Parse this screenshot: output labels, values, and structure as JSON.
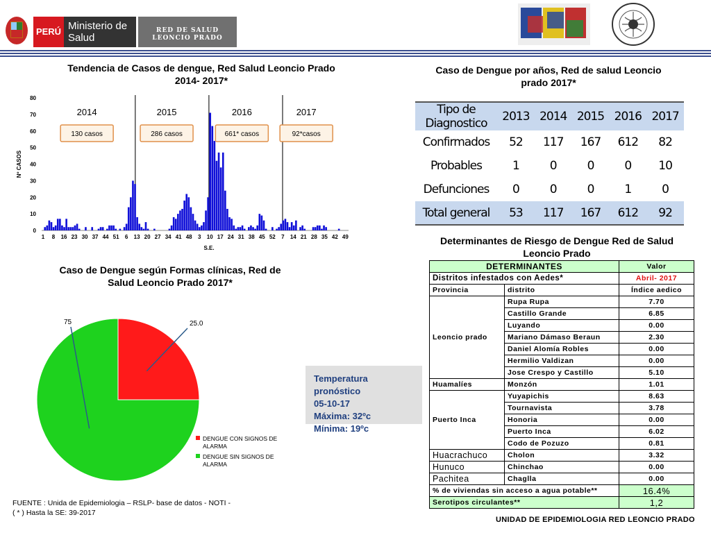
{
  "header": {
    "peru_label": "PERÚ",
    "ministerio_label": "Ministerio de Salud",
    "red_label_1": "RED DE SALUD",
    "red_label_2": "LEONCIO PRADO"
  },
  "chart_data": [
    {
      "type": "bar",
      "title": "Tendencia de Casos de dengue, Red Salud Leoncio Prado 2014- 2017*",
      "xlabel": "S.E.",
      "ylabel": "Nº CASOS",
      "ylim": [
        0,
        80
      ],
      "yticks": [
        "0",
        "10",
        "20",
        "30",
        "40",
        "50",
        "60",
        "70",
        "80"
      ],
      "xticks": [
        "1",
        "8",
        "16",
        "23",
        "30",
        "37",
        "44",
        "51",
        "6",
        "13",
        "20",
        "27",
        "34",
        "41",
        "48",
        "3",
        "10",
        "17",
        "24",
        "31",
        "38",
        "45",
        "52",
        "7",
        "14",
        "21",
        "28",
        "35",
        "42",
        "49"
      ],
      "values": [
        0,
        2,
        3,
        6,
        5,
        2,
        3,
        7,
        7,
        3,
        2,
        7,
        2,
        2,
        2,
        3,
        4,
        1,
        0,
        0,
        2,
        0,
        0,
        2,
        0,
        0,
        1,
        2,
        2,
        0,
        1,
        3,
        3,
        3,
        1,
        0,
        1,
        0,
        2,
        4,
        14,
        20,
        30,
        28,
        8,
        4,
        2,
        1,
        5,
        1,
        0,
        0,
        1,
        0,
        0,
        0,
        0,
        0,
        0,
        1,
        3,
        8,
        7,
        10,
        12,
        13,
        18,
        22,
        20,
        14,
        10,
        6,
        4,
        2,
        3,
        5,
        12,
        20,
        71,
        63,
        54,
        42,
        47,
        38,
        47,
        24,
        13,
        8,
        7,
        3,
        1,
        2,
        2,
        3,
        1,
        0,
        2,
        3,
        2,
        1,
        3,
        10,
        9,
        6,
        1,
        0,
        0,
        2,
        0,
        1,
        2,
        4,
        6,
        7,
        5,
        2,
        5,
        3,
        6,
        0,
        2,
        3,
        1,
        0,
        0,
        0,
        2,
        2,
        3,
        3,
        1,
        3,
        2,
        0,
        0,
        0,
        0,
        0,
        1,
        0,
        0,
        0,
        0
      ],
      "periods": [
        {
          "year": "2014",
          "cases": "130 casos"
        },
        {
          "year": "2015",
          "cases": "286 casos"
        },
        {
          "year": "2016",
          "cases": "661* casos"
        },
        {
          "year": "2017",
          "cases": "92*casos"
        }
      ]
    },
    {
      "type": "table",
      "title": "Caso de Dengue por años, Red de salud Leoncio prado 2017*",
      "columns": [
        "Tipo de Diagnostico",
        "2013",
        "2014",
        "2015",
        "2016",
        "2017"
      ],
      "rows": [
        [
          "Confirmados",
          "52",
          "117",
          "167",
          "612",
          "82"
        ],
        [
          "Probables",
          "1",
          "0",
          "0",
          "0",
          "10"
        ],
        [
          "Defunciones",
          "0",
          "0",
          "0",
          "1",
          "0"
        ],
        [
          "Total general",
          "53",
          "117",
          "167",
          "612",
          "92"
        ]
      ]
    },
    {
      "type": "pie",
      "title": "Caso de Dengue según Formas clínicas, Red de Salud Leoncio Prado 2017*",
      "slices": [
        {
          "label": "DENGUE CON SIGNOS DE ALARMA",
          "value": 25.0,
          "value_label": "25.0",
          "color": "#ff1a1a"
        },
        {
          "label": "DENGUE SIN SIGNOS DE ALARMA",
          "value": 75,
          "value_label": "75",
          "color": "#1ed21e"
        }
      ]
    }
  ],
  "temperature": {
    "line1": "Temperatura pronóstico",
    "line2": "05-10-17",
    "line3": "Máxima: 32ºc",
    "line4": "Mínima: 19ºc"
  },
  "determinants": {
    "title": "Determinantes de Riesgo de Dengue Red de Salud Leoncio Prado",
    "head": "DETERMINANTES",
    "head_value": "Valor",
    "districts_label": "Distritos infestados con Aedes*",
    "month": "Abril- 2017",
    "col_prov": "Provincia",
    "col_dist": "distrito",
    "col_idx": "Índice aedico",
    "groups": [
      {
        "prov": "Leoncio prado",
        "rows": [
          [
            "Rupa Rupa",
            "7.70"
          ],
          [
            "Castillo Grande",
            "6.85"
          ],
          [
            "Luyando",
            "0.00"
          ],
          [
            "Mariano Dámaso Beraun",
            "2.30"
          ],
          [
            "Daniel Alomía Robles",
            "0.00"
          ],
          [
            "Hermilio Valdizan",
            "0.00"
          ],
          [
            "Jose Crespo y Castillo",
            "5.10"
          ]
        ]
      },
      {
        "prov": "Huamalíes",
        "rows": [
          [
            "Monzón",
            "1.01"
          ]
        ]
      },
      {
        "prov": "Puerto Inca",
        "rows": [
          [
            "Yuyapichis",
            "8.63"
          ],
          [
            "Tournavista",
            "3.78"
          ],
          [
            "Honoria",
            "0.00"
          ],
          [
            "Puerto Inca",
            "6.02"
          ],
          [
            "Codo de Pozuzo",
            "0.81"
          ]
        ]
      },
      {
        "prov": "Huacrachuco",
        "rows": [
          [
            "Cholon",
            "3.32"
          ]
        ]
      },
      {
        "prov": "Hunuco",
        "rows": [
          [
            "Chinchao",
            "0.00"
          ]
        ]
      },
      {
        "prov": "Pachitea",
        "rows": [
          [
            "Chaglla",
            "0.00"
          ]
        ]
      }
    ],
    "water_label": "% de viviendas sin acceso a agua potable**",
    "water_value": "16.4%",
    "sero_label": "Serotipos circulantes**",
    "sero_value": "1,2"
  },
  "footer": {
    "line1": "FUENTE : Unida de Epidemiologia – RSLP- base de datos - NOTI -",
    "line2": "( * ) Hasta la SE: 39-2017",
    "unit": "UNIDAD DE EPIDEMIOLOGIA RED LEONCIO PRADO"
  }
}
